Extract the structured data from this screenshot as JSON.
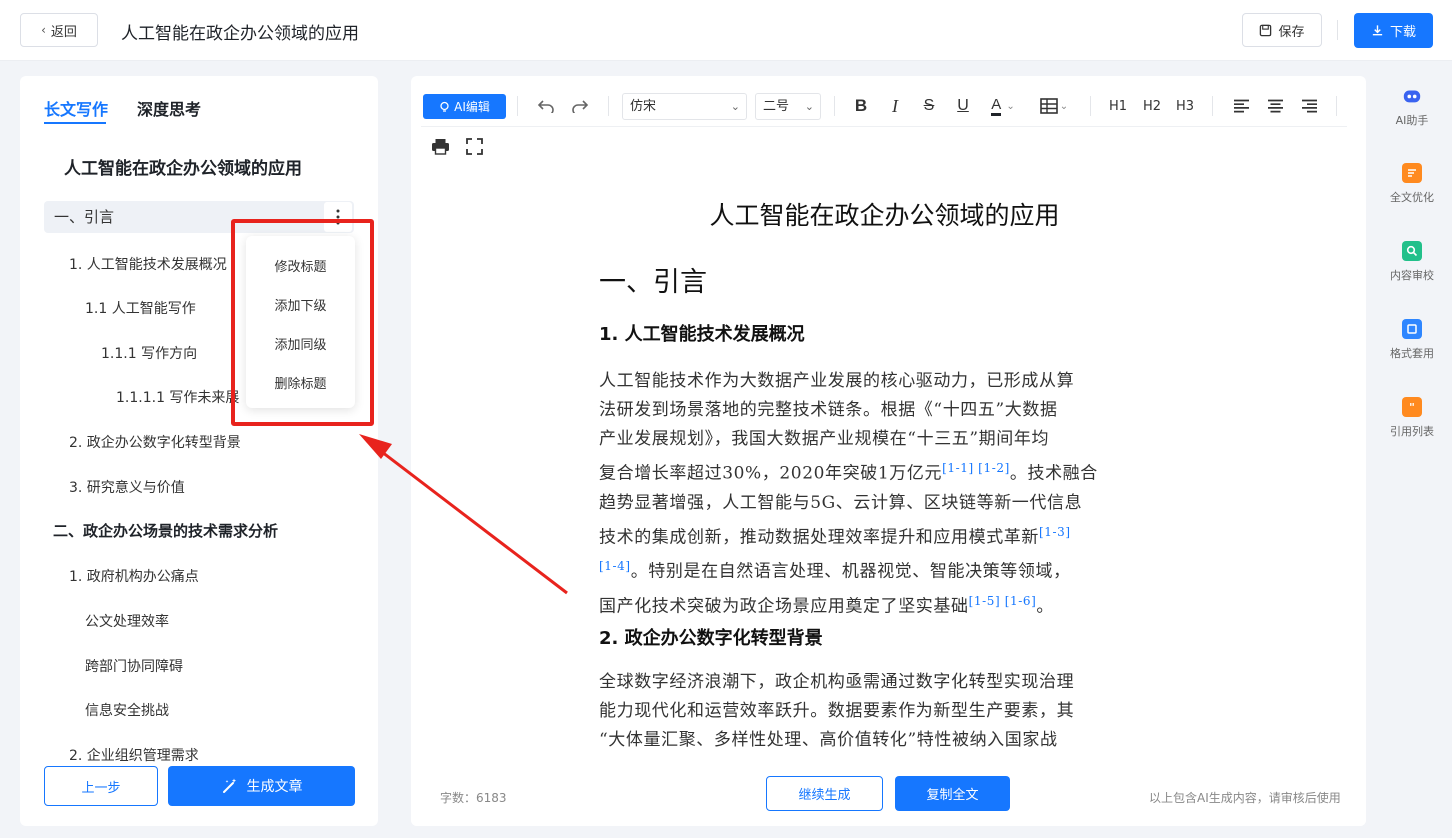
{
  "header": {
    "back_label": "返回",
    "title": "人工智能在政企办公领域的应用",
    "save_label": "保存",
    "download_label": "下载"
  },
  "left": {
    "tabs": [
      "长文写作",
      "深度思考"
    ],
    "outline_title": "人工智能在政企办公领域的应用",
    "items": [
      {
        "label": "一、引言"
      },
      {
        "label": "1. 人工智能技术发展概况"
      },
      {
        "label": "1.1 人工智能写作"
      },
      {
        "label": "1.1.1 写作方向"
      },
      {
        "label": "1.1.1.1 写作未来展"
      },
      {
        "label": "2. 政企办公数字化转型背景"
      },
      {
        "label": "3. 研究意义与价值"
      },
      {
        "label": "二、政企办公场景的技术需求分析"
      },
      {
        "label": "1. 政府机构办公痛点"
      },
      {
        "label": "公文处理效率"
      },
      {
        "label": "跨部门协同障碍"
      },
      {
        "label": "信息安全挑战"
      },
      {
        "label": "2. 企业组织管理需求"
      }
    ],
    "context_menu": [
      "修改标题",
      "添加下级",
      "添加同级",
      "删除标题"
    ],
    "prev_label": "上一步",
    "generate_label": "生成文章"
  },
  "editor": {
    "ai_edit_label": "AI编辑",
    "font_family": "仿宋",
    "font_size": "二号",
    "headings": [
      "H1",
      "H2",
      "H3"
    ],
    "doc_title": "人工智能在政企办公领域的应用",
    "h1": "一、引言",
    "section1_heading": "1.  人工智能技术发展概况",
    "section1_lines": [
      {
        "text": "人工智能技术作为大数据产业发展的核心驱动力，已形成从算"
      },
      {
        "text": "法研发到场景落地的完整技术链条。根据《“十四五”大数据"
      },
      {
        "text": "产业发展规划》，我国大数据产业规模在“十三五”期间年均"
      },
      {
        "text": "复合增长率超过30%，2020年突破1万亿元",
        "cite": "[1-1] [1-2]",
        "tail": "。技术融合"
      },
      {
        "text": "趋势显著增强，人工智能与5G、云计算、区块链等新一代信息"
      },
      {
        "text": "技术的集成创新，推动数据处理效率提升和应用模式革新",
        "cite": "[1-3]"
      },
      {
        "text": "",
        "cite": "[1-4]",
        "tail": "。特别是在自然语言处理、机器视觉、智能决策等领域，"
      },
      {
        "text": "国产化技术突破为政企场景应用奠定了坚实基础",
        "cite": "[1-5] [1-6]",
        "tail": "。"
      }
    ],
    "section2_heading": "2.  政企办公数字化转型背景",
    "section2_lines": [
      {
        "text": "全球数字经济浪潮下，政企机构亟需通过数字化转型实现治理"
      },
      {
        "text": "能力现代化和运营效率跃升。数据要素作为新型生产要素，其"
      },
      {
        "text": "“大体量汇聚、多样性处理、高价值转化”特性被纳入国家战"
      }
    ],
    "word_count": "字数：6183",
    "continue_label": "继续生成",
    "copy_label": "复制全文",
    "disclaimer": "以上包含AI生成内容，请审核后使用"
  },
  "rail": [
    {
      "label": "AI助手",
      "icon": "robot-icon",
      "color": "#3a63f0"
    },
    {
      "label": "全文优化",
      "icon": "doc-optimize-icon",
      "color": "#ff8a1f"
    },
    {
      "label": "内容审校",
      "icon": "review-icon",
      "color": "#22c08a"
    },
    {
      "label": "格式套用",
      "icon": "format-icon",
      "color": "#2e86ff"
    },
    {
      "label": "引用列表",
      "icon": "quote-icon",
      "color": "#ff8a1f"
    }
  ]
}
